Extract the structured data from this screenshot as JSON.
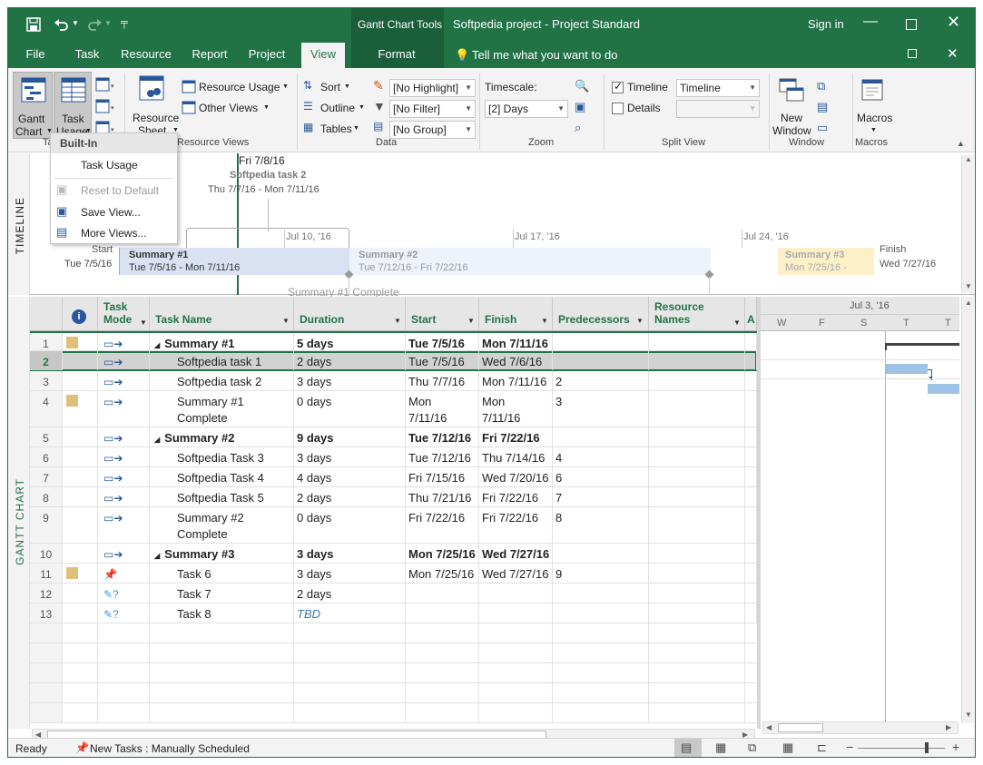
{
  "titlebar": {
    "context_tab": "Gantt Chart Tools",
    "title": "Softpedia project - Project Standard",
    "signin": "Sign in"
  },
  "tabs": [
    "File",
    "Task",
    "Resource",
    "Report",
    "Project",
    "View",
    "Format"
  ],
  "tell_me": "Tell me what you want to do",
  "ribbon": {
    "gantt_chart": "Gantt",
    "gantt_chart2": "Chart",
    "task_usage": "Task",
    "task_usage2": "Usage",
    "resource_sheet": "Resource",
    "resource_sheet2": "Sheet",
    "resource_usage": "Resource Usage",
    "other_views": "Other Views",
    "group_task_views": "Ta",
    "group_resource_views": "Resource Views",
    "sort": "Sort",
    "outline": "Outline",
    "tables": "Tables",
    "highlight": "[No Highlight]",
    "filter": "[No Filter]",
    "group": "[No Group]",
    "group_data": "Data",
    "timescale_label": "Timescale:",
    "timescale_value": "[2] Days",
    "group_zoom": "Zoom",
    "timeline_check": "Timeline",
    "timeline_value": "Timeline",
    "details_check": "Details",
    "group_split": "Split View",
    "new_window": "New",
    "new_window2": "Window",
    "group_window": "Window",
    "macros": "Macros",
    "group_macros": "Macros"
  },
  "dropdown": {
    "header": "Built-In",
    "items": [
      "Task Usage",
      "Reset to Default",
      "Save View...",
      "More Views..."
    ]
  },
  "timeline": {
    "label": "TIMELINE",
    "today": "Fri 7/8/16",
    "callout_task": "Softpedia task 2",
    "callout_dates": "Thu 7/7/16 - Mon 7/11/16",
    "start_label": "Start",
    "start_date": "Tue 7/5/16",
    "finish_label": "Finish",
    "finish_date": "Wed 7/27/16",
    "ticks": [
      "Jul 10, '16",
      "Jul 17, '16",
      "Jul 24, '16"
    ],
    "bars": [
      {
        "name": "Summary #1",
        "dates": "Tue 7/5/16 - Mon 7/11/16"
      },
      {
        "name": "Summary #2",
        "dates": "Tue 7/12/16 - Fri 7/22/16"
      },
      {
        "name": "Summary #3",
        "dates": "Mon 7/25/16 -"
      }
    ],
    "milestone": "Summary #1 Complete"
  },
  "gantt": {
    "label": "GANTT CHART",
    "headers": {
      "task_mode": "Task Mode",
      "task_name": "Task Name",
      "duration": "Duration",
      "start": "Start",
      "finish": "Finish",
      "predecessors": "Predecessors",
      "resource_names": "Resource Names",
      "add": "A"
    },
    "chart_header": {
      "date": "Jul 3, '16",
      "days": [
        "W",
        "F",
        "S",
        "T",
        "T"
      ]
    },
    "rows": [
      {
        "id": "1",
        "name": "Summary #1",
        "duration": "5 days",
        "start": "Tue 7/5/16",
        "finish": "Mon 7/11/16",
        "pred": "",
        "bold": true,
        "summary": true
      },
      {
        "id": "2",
        "name": "Softpedia task 1",
        "duration": "2 days",
        "start": "Tue 7/5/16",
        "finish": "Wed 7/6/16",
        "pred": ""
      },
      {
        "id": "3",
        "name": "Softpedia task 2",
        "duration": "3 days",
        "start": "Thu 7/7/16",
        "finish": "Mon 7/11/16",
        "pred": "2"
      },
      {
        "id": "4",
        "name": "Summary #1",
        "name2": "Complete",
        "duration": "0 days",
        "start": "Mon",
        "start2": "7/11/16",
        "finish": "Mon",
        "finish2": "7/11/16",
        "pred": "3"
      },
      {
        "id": "5",
        "name": "Summary #2",
        "duration": "9 days",
        "start": "Tue 7/12/16",
        "finish": "Fri 7/22/16",
        "pred": "",
        "bold": true,
        "summary": true
      },
      {
        "id": "6",
        "name": "Softpedia Task 3",
        "duration": "3 days",
        "start": "Tue 7/12/16",
        "finish": "Thu 7/14/16",
        "pred": "4"
      },
      {
        "id": "7",
        "name": "Softpedia Task 4",
        "duration": "4 days",
        "start": "Fri 7/15/16",
        "finish": "Wed 7/20/16",
        "pred": "6"
      },
      {
        "id": "8",
        "name": "Softpedia Task 5",
        "duration": "2 days",
        "start": "Thu 7/21/16",
        "finish": "Fri 7/22/16",
        "pred": "7"
      },
      {
        "id": "9",
        "name": "Summary #2",
        "name2": "Complete",
        "duration": "0 days",
        "start": "Fri 7/22/16",
        "finish": "Fri 7/22/16",
        "pred": "8"
      },
      {
        "id": "10",
        "name": "Summary #3",
        "duration": "3 days",
        "start": "Mon 7/25/16",
        "finish": "Wed 7/27/16",
        "pred": "",
        "bold": true,
        "summary": true
      },
      {
        "id": "11",
        "name": "Task 6",
        "duration": "3 days",
        "start": "Mon 7/25/16",
        "finish": "Wed 7/27/16",
        "pred": "9"
      },
      {
        "id": "12",
        "name": "Task 7",
        "duration": "2 days",
        "start": "",
        "finish": "",
        "pred": ""
      },
      {
        "id": "13",
        "name": "Task 8",
        "duration": "TBD",
        "start": "",
        "finish": "",
        "pred": ""
      }
    ]
  },
  "status": {
    "ready": "Ready",
    "new_tasks": "New Tasks : Manually Scheduled"
  },
  "colors": {
    "brand": "#217346",
    "summary1_bar": "#d9e1f2",
    "summary2_bar": "#eef2fa",
    "summary3_bar": "#fdf0c8",
    "task_bar": "#9dc3e6",
    "today_line": "#217346"
  }
}
